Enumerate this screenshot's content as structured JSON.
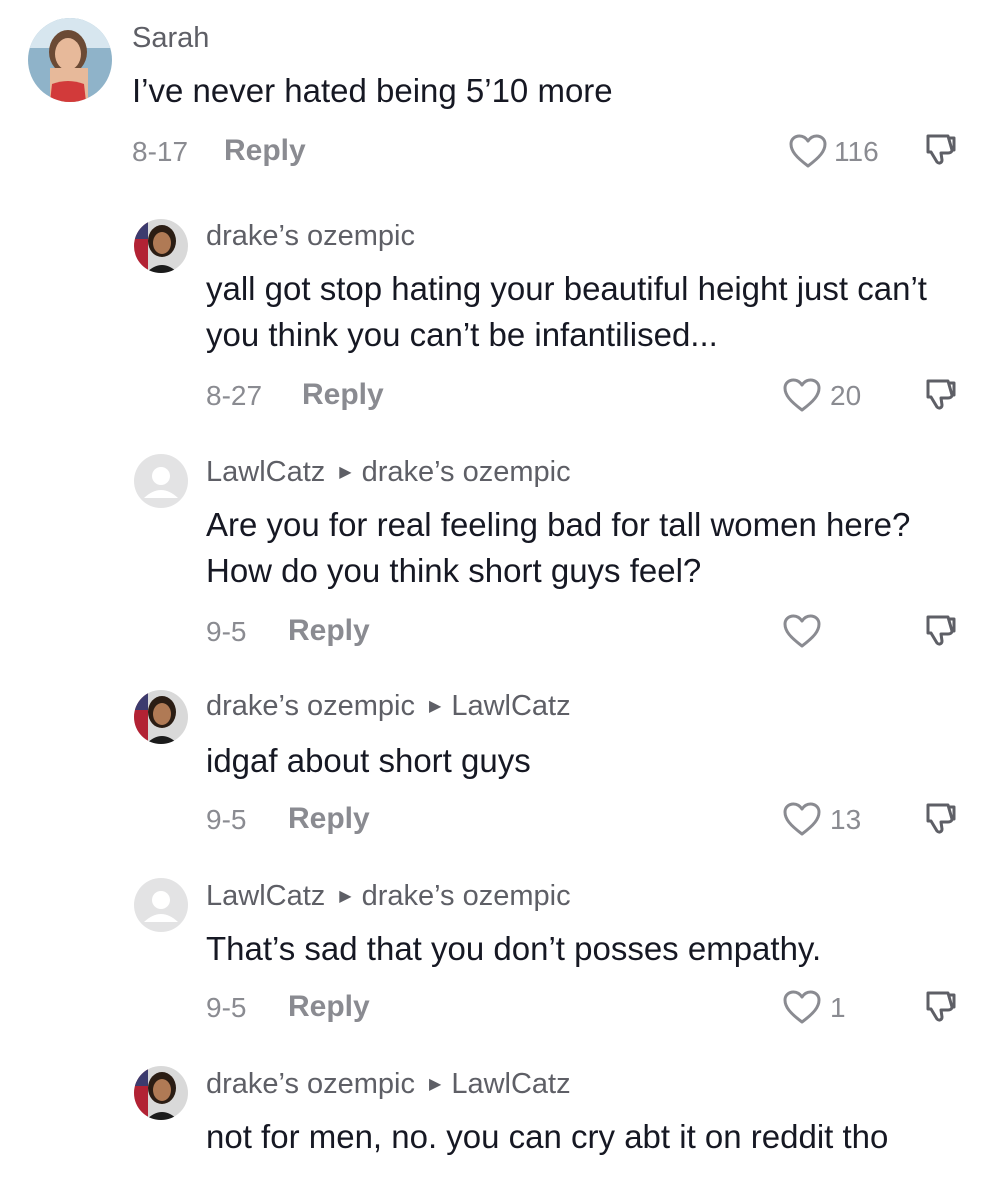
{
  "comments": [
    {
      "user": "Sarah",
      "reply_to": "",
      "text": "I’ve never hated being 5’10 more",
      "date": "8-17",
      "reply_label": "Reply",
      "likes": "116",
      "avatar": "sarah-avatar"
    },
    {
      "user": "drake’s ozempic",
      "reply_to": "",
      "text": "yall got stop hating your beautiful height just can’t you think you can’t be infantilised...",
      "date": "8-27",
      "reply_label": "Reply",
      "likes": "20",
      "avatar": "drake-avatar"
    },
    {
      "user": "LawlCatz",
      "reply_to": "drake’s ozempic",
      "text": "Are you for real feeling bad for tall women here? How do you think short guys feel?",
      "date": "9-5",
      "reply_label": "Reply",
      "likes": "",
      "avatar": "default-avatar"
    },
    {
      "user": "drake’s ozempic",
      "reply_to": "LawlCatz",
      "text": "idgaf about short guys",
      "date": "9-5",
      "reply_label": "Reply",
      "likes": "13",
      "avatar": "drake-avatar"
    },
    {
      "user": "LawlCatz",
      "reply_to": "drake’s ozempic",
      "text": "That’s sad that you don’t posses empathy.",
      "date": "9-5",
      "reply_label": "Reply",
      "likes": "1",
      "avatar": "default-avatar"
    },
    {
      "user": "drake’s ozempic",
      "reply_to": "LawlCatz",
      "text": "not for men, no. you can cry abt it on reddit tho",
      "date": "",
      "reply_label": "",
      "likes": "",
      "avatar": "drake-avatar"
    }
  ],
  "icons": {
    "like": "heart-outline-icon",
    "dislike": "thumbs-down-icon",
    "reply_arrow": "triangle-right-icon"
  },
  "colors": {
    "text": "#161823",
    "name": "#5e5f66",
    "meta": "#8a8b91"
  }
}
